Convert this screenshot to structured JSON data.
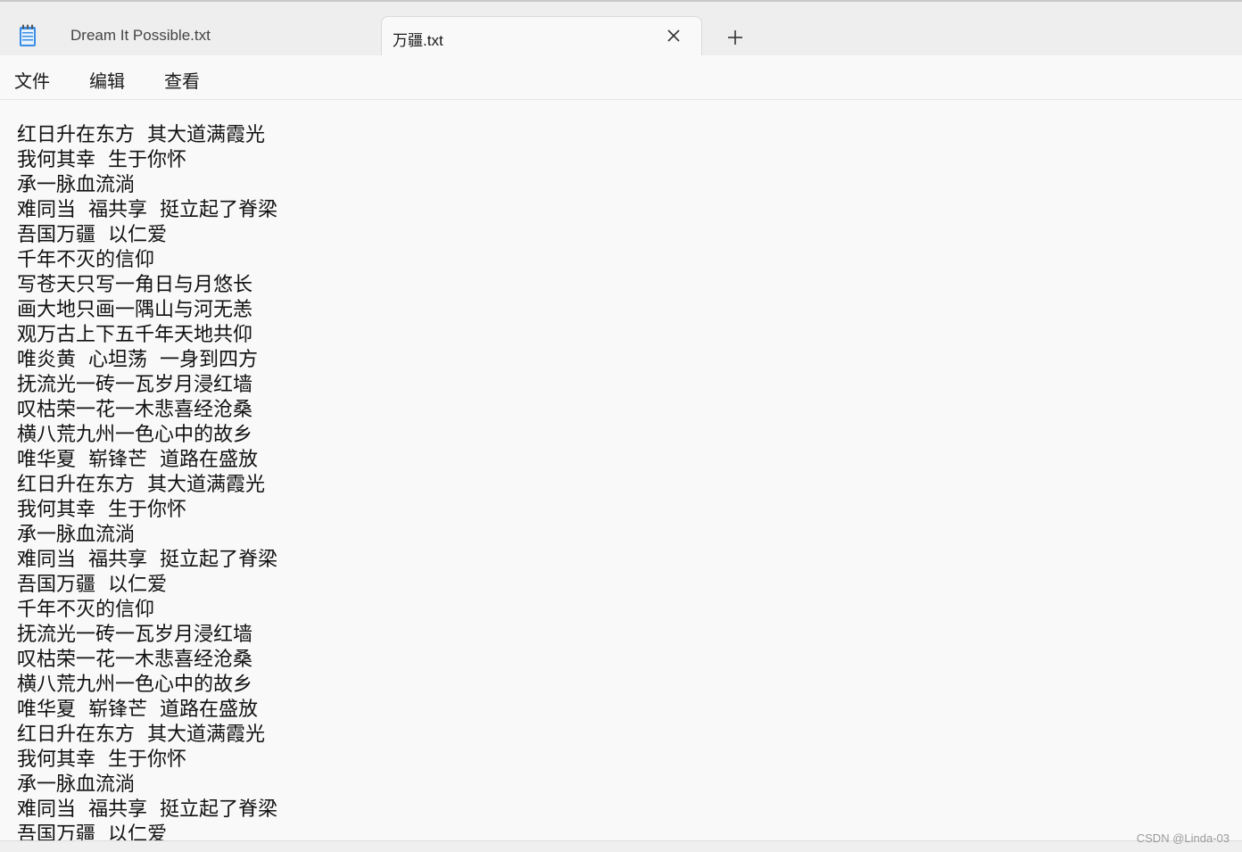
{
  "tabs": [
    {
      "label": "Dream It Possible.txt",
      "active": false
    },
    {
      "label": "万疆.txt",
      "active": true
    }
  ],
  "menu": [
    "文件",
    "编辑",
    "查看"
  ],
  "editor": {
    "lines": [
      "红日升在东方  其大道满霞光",
      "我何其幸  生于你怀",
      "承一脉血流淌",
      "难同当  福共享  挺立起了脊梁",
      "吾国万疆  以仁爱",
      "千年不灭的信仰",
      "写苍天只写一角日与月悠长",
      "画大地只画一隅山与河无恙",
      "观万古上下五千年天地共仰",
      "唯炎黄  心坦荡  一身到四方",
      "抚流光一砖一瓦岁月浸红墙",
      "叹枯荣一花一木悲喜经沧桑",
      "横八荒九州一色心中的故乡",
      "唯华夏  崭锋芒  道路在盛放",
      "红日升在东方  其大道满霞光",
      "我何其幸  生于你怀",
      "承一脉血流淌",
      "难同当  福共享  挺立起了脊梁",
      "吾国万疆  以仁爱",
      "千年不灭的信仰",
      "抚流光一砖一瓦岁月浸红墙",
      "叹枯荣一花一木悲喜经沧桑",
      "横八荒九州一色心中的故乡",
      "唯华夏  崭锋芒  道路在盛放",
      "红日升在东方  其大道满霞光",
      "我何其幸  生于你怀",
      "承一脉血流淌",
      "难同当  福共享  挺立起了脊梁",
      "吾国万疆  以仁爱"
    ]
  },
  "watermark": "CSDN @Linda-03",
  "icons": {
    "app": "notepad-icon",
    "close": "close-icon",
    "add": "plus-icon"
  },
  "colors": {
    "accent": "#2b6cc4",
    "tab_bar": "#eeeeee",
    "editor_bg": "#f9f9f9"
  }
}
